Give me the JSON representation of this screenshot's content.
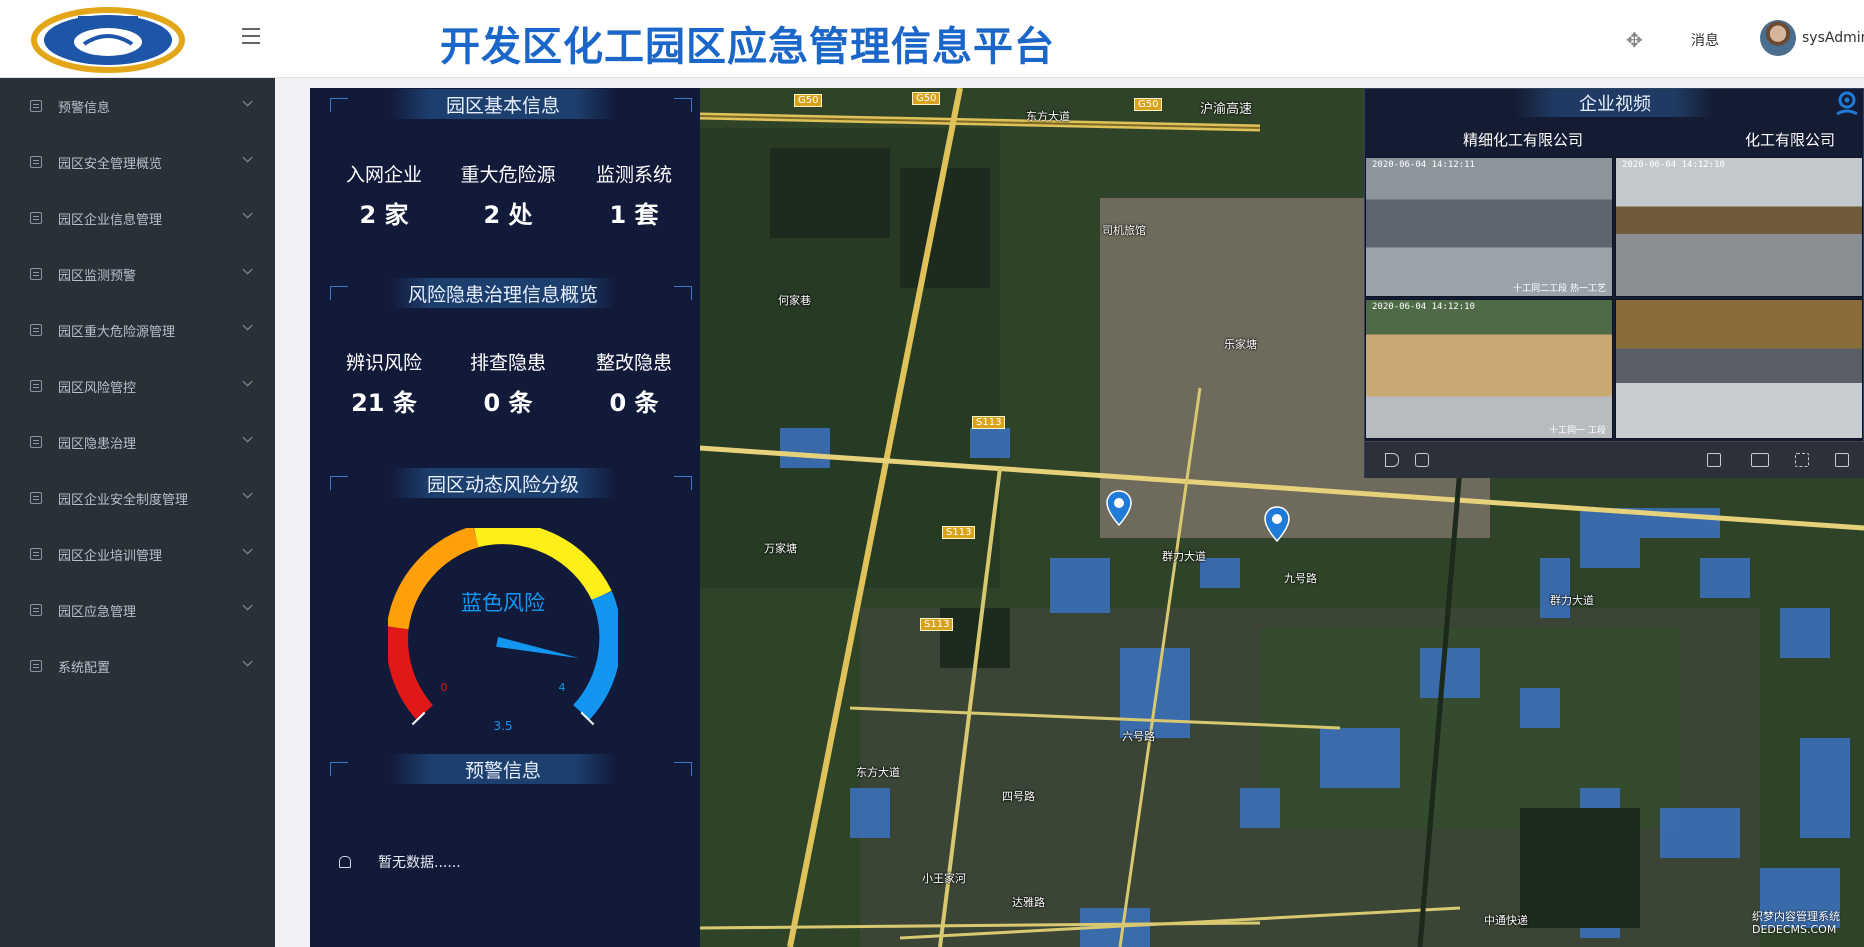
{
  "header": {
    "title": "开发区化工园区应急管理信息平台",
    "message_label": "消息",
    "username": "sysAdmin"
  },
  "sidebar": {
    "items": [
      {
        "label": "预警信息"
      },
      {
        "label": "园区安全管理概览"
      },
      {
        "label": "园区企业信息管理"
      },
      {
        "label": "园区监测预警"
      },
      {
        "label": "园区重大危险源管理"
      },
      {
        "label": "园区风险管控"
      },
      {
        "label": "园区隐患治理"
      },
      {
        "label": "园区企业安全制度管理"
      },
      {
        "label": "园区企业培训管理"
      },
      {
        "label": "园区应急管理"
      },
      {
        "label": "系统配置"
      }
    ]
  },
  "park_info": {
    "title": "园区基本信息",
    "stats": [
      {
        "label": "入网企业",
        "value": "2 家"
      },
      {
        "label": "重大危险源",
        "value": "2 处"
      },
      {
        "label": "监测系统",
        "value": "1 套"
      }
    ]
  },
  "risk_overview": {
    "title": "风险隐患治理信息概览",
    "stats": [
      {
        "label": "辨识风险",
        "value": "21 条"
      },
      {
        "label": "排查隐患",
        "value": "0 条"
      },
      {
        "label": "整改隐患",
        "value": "0 条"
      }
    ]
  },
  "risk_level": {
    "title": "园区动态风险分级",
    "gauge_label": "蓝色风险",
    "min_label": "0",
    "max_label": "4",
    "value": 3.5,
    "value_label": "3.5",
    "max": 4
  },
  "alerts": {
    "title": "预警信息",
    "empty_text": "暂无数据......"
  },
  "video": {
    "title": "企业视频",
    "tabs": [
      "精细化工有限公司",
      "化工有限公司"
    ],
    "cameras": [
      {
        "timestamp": "2020-06-04  14:12:11",
        "caption": "十工同二工段  热一工艺"
      },
      {
        "timestamp": "2020-06-04  14:12:10",
        "caption": ""
      },
      {
        "timestamp": "2020-06-04  14:12:10",
        "caption": "十工同一 工段"
      },
      {
        "timestamp": "",
        "caption": ""
      }
    ]
  },
  "map": {
    "labels": [
      "沪渝高速",
      "司机旅馆",
      "何家巷",
      "乐家塘",
      "万家塘",
      "群力大道",
      "东方大道",
      "六号路",
      "四号路",
      "小王家河",
      "达雅路",
      "中通快递",
      "九号路"
    ],
    "shields": [
      "G50",
      "G50",
      "G50",
      "S113",
      "S113",
      "S113"
    ]
  },
  "watermark": {
    "line1": "织梦内容管理系统",
    "line2": "DEDECMS.COM"
  },
  "colors": {
    "accent": "#1b66c9",
    "panel_bg": "#121a3a",
    "sidebar_bg": "#293038",
    "gauge_blue": "#1296f0"
  }
}
